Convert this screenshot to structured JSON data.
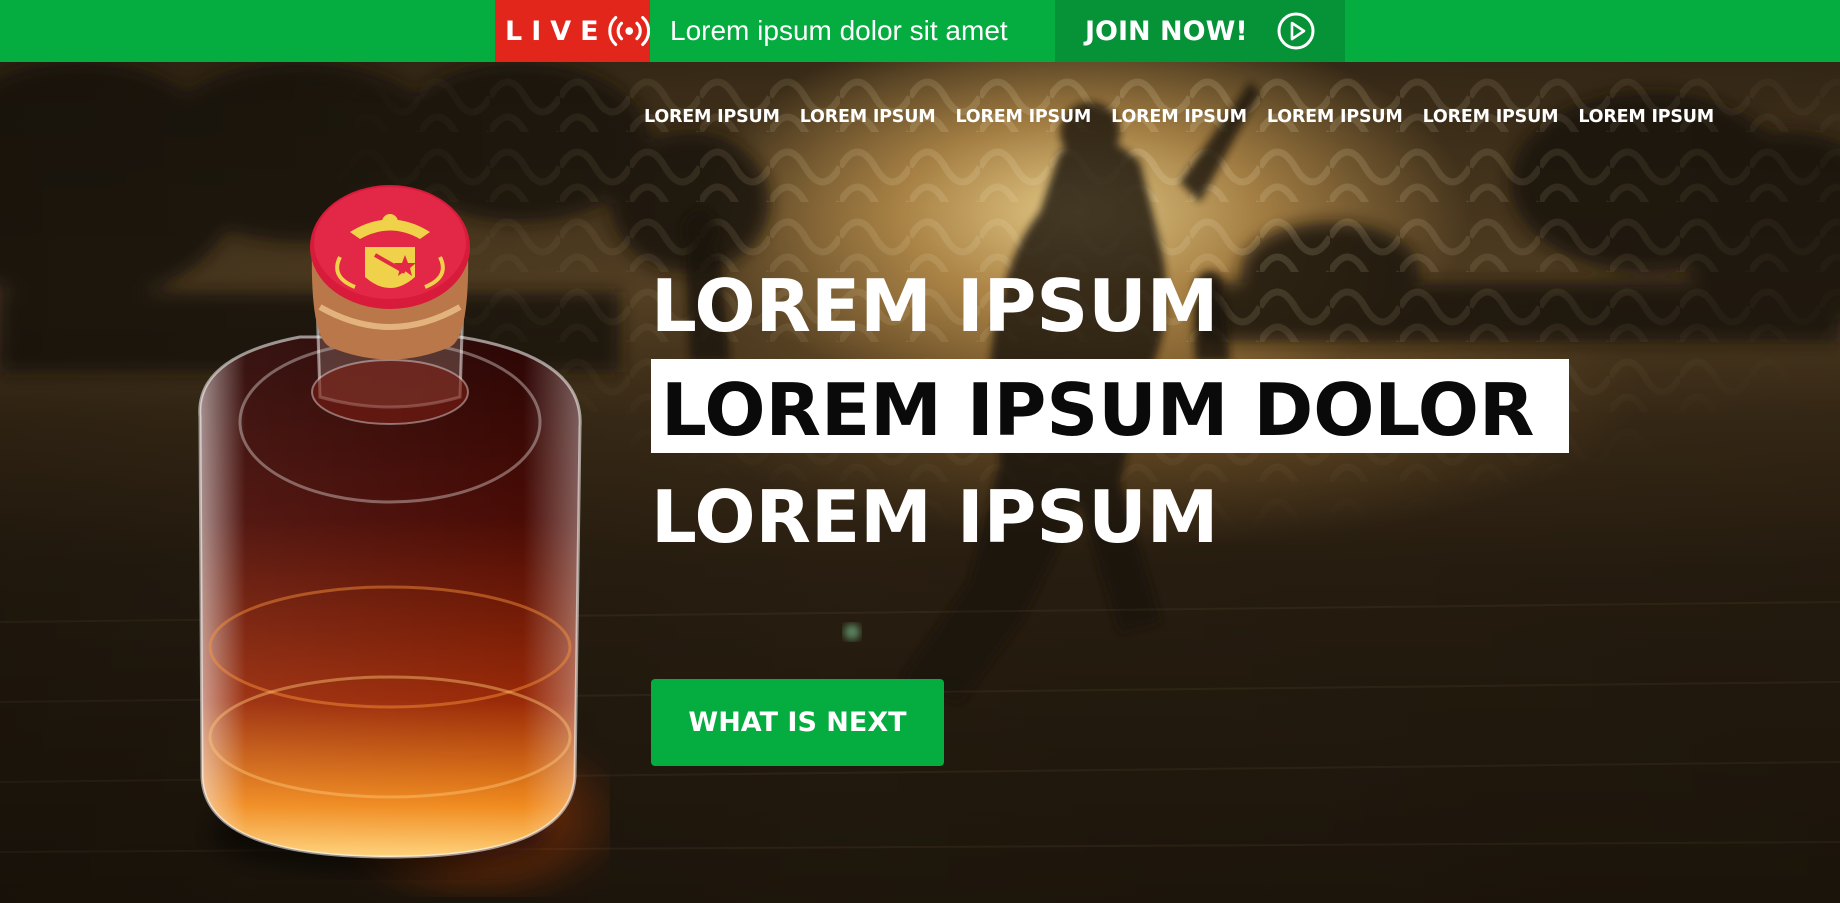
{
  "topbar": {
    "live_label": "LIVE",
    "promo_text": "Lorem ipsum dolor sit amet",
    "join_label": "JOIN NOW!",
    "colors": {
      "bar": "#05ac3f",
      "live": "#e2261c",
      "join": "#069236"
    }
  },
  "nav": {
    "items": [
      "LOREM IPSUM",
      "LOREM IPSUM",
      "LOREM IPSUM",
      "LOREM IPSUM",
      "LOREM IPSUM",
      "LOREM IPSUM",
      "LOREM IPSUM"
    ]
  },
  "hero": {
    "line1": "LOREM IPSUM",
    "line2": "LOREM IPSUM DOLOR",
    "line3": "LOREM IPSUM",
    "cta_label": "WHAT IS NEXT",
    "accent": "#05ac3f"
  },
  "icons": {
    "live": "broadcast-icon",
    "join": "play-circle-icon"
  }
}
